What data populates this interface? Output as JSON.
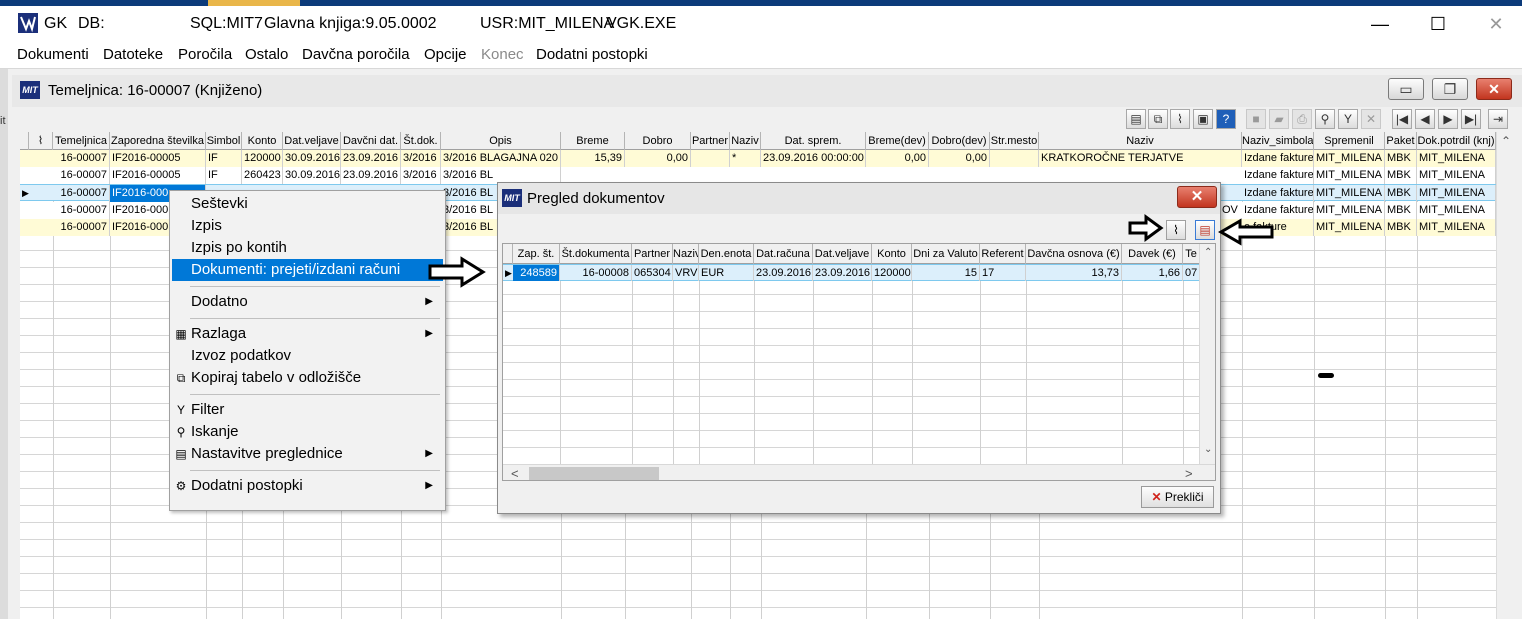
{
  "window": {
    "app_name": "GK",
    "db_label": "DB:",
    "sql": "SQL:MIT7",
    "version": "Glavna knjiga:9.05.0002",
    "user": "USR:MIT_MILENA",
    "exe": "VGK.EXE",
    "minimize_glyph": "—",
    "maximize_glyph": "☐",
    "close_glyph": "✕"
  },
  "menubar": {
    "items": [
      "Dokumenti",
      "Datoteke",
      "Poročila",
      "Ostalo",
      "Davčna poročila",
      "Opcije",
      "Konec",
      "Dodatni postopki"
    ]
  },
  "left_edge_label": "it",
  "child_window": {
    "logo": "MIT",
    "title": "Temeljnica: 16-00007  (Knjiženo)",
    "min_glyph": "▭",
    "restore_glyph": "❐",
    "close_glyph": "✕"
  },
  "toolbar_icons": [
    "document-icon",
    "copy-icon",
    "paperclip-icon",
    "monitor-icon",
    "help-icon",
    "square-icon",
    "folder-icon",
    "print-icon",
    "search-icon",
    "filter-icon",
    "cancel-icon",
    "first-icon",
    "prev-icon",
    "next-icon",
    "last-icon",
    "exit-icon"
  ],
  "toolbar_glyphs": [
    "▤",
    "⧉",
    "⌇",
    "▣",
    "?",
    "■",
    "▰",
    "⎙",
    "⚲",
    "Y",
    "✕",
    "|◀",
    "◀",
    "▶",
    "▶|",
    "⇥"
  ],
  "grid": {
    "attach_glyph": "⌇",
    "columns": [
      "Temeljnica",
      "Zaporedna številka",
      "Simbol",
      "Konto",
      "Dat.veljave",
      "Davčni dat.",
      "Št.dok.",
      "Opis",
      "Breme",
      "Dobro",
      "Partner",
      "Naziv",
      "Dat. sprem.",
      "Breme(dev)",
      "Dobro(dev)",
      "Str.mesto",
      "Naziv",
      "Naziv_simbola",
      "Spremenil",
      "Paket",
      "Dok.potrdil (knj)"
    ],
    "rows": [
      [
        "16-00007",
        "IF2016-00005",
        "IF",
        "120000",
        "30.09.2016",
        "23.09.2016",
        "3/2016",
        "3/2016 BLAGAJNA 020",
        "15,39",
        "0,00",
        "",
        "*",
        "23.09.2016 00:00:00",
        "0,00",
        "0,00",
        "",
        "KRATKOROČNE TERJATVE",
        "Izdane fakture",
        "MIT_MILENA",
        "MBK",
        "MIT_MILENA"
      ],
      [
        "16-00007",
        "IF2016-00005",
        "IF",
        "260423",
        "30.09.2016",
        "23.09.2016",
        "3/2016",
        "3/2016 BL",
        "",
        "",
        "",
        "",
        "",
        "",
        "",
        "",
        "",
        "Izdane fakture",
        "MIT_MILENA",
        "MBK",
        "MIT_MILENA"
      ],
      [
        "16-00007",
        "IF2016-000",
        "",
        "",
        "",
        "",
        "",
        "3/2016 BL",
        "",
        "",
        "",
        "",
        "",
        "",
        "",
        "",
        "",
        "Izdane fakture",
        "MIT_MILENA",
        "MBK",
        "MIT_MILENA"
      ],
      [
        "16-00007",
        "IF2016-000",
        "",
        "",
        "",
        "",
        "",
        "3/2016 BL",
        "",
        "",
        "",
        "",
        "",
        "",
        "",
        "",
        "OV",
        "Izdane fakture",
        "MIT_MILENA",
        "MBK",
        "MIT_MILENA"
      ],
      [
        "16-00007",
        "IF2016-000",
        "",
        "",
        "",
        "",
        "",
        "3/2016 BL",
        "",
        "",
        "",
        "",
        "",
        "",
        "",
        "",
        "",
        "e fakture",
        "MIT_MILENA",
        "MBK",
        "MIT_MILENA"
      ]
    ],
    "row_marker": "▶",
    "scroll_up": "⌃"
  },
  "context_menu": {
    "items": [
      "Seštevki",
      "Izpis",
      "Izpis po kontih",
      "Dokumenti: prejeti/izdani računi",
      "Dodatno",
      "Razlaga",
      "Izvoz podatkov",
      "Kopiraj tabelo v odložišče",
      "Filter",
      "Iskanje",
      "Nastavitve preglednice",
      "Dodatni postopki"
    ],
    "submenu_glyph": "▶"
  },
  "dialog": {
    "logo": "MIT",
    "title": "Pregled dokumentov",
    "close_glyph": "✕",
    "attach_glyph": "⌇",
    "doc_glyph": "▤",
    "columns": [
      "Zap. št.",
      "Št.dokumenta",
      "Partner",
      "Naziv",
      "Den.enota",
      "Dat.računa",
      "Dat.veljave",
      "Konto",
      "Dni za Valuto",
      "Referent",
      "Davčna osnova (€)",
      "Davek (€)",
      "Te"
    ],
    "row": [
      "248589",
      "16-00008",
      "065304",
      "VRV",
      "EUR",
      "23.09.2016",
      "23.09.2016",
      "120000",
      "15",
      "17",
      "13,73",
      "1,66",
      "07"
    ],
    "row_marker": "▶",
    "scroll_up": "⌃",
    "scroll_down": "⌄",
    "scroll_left": "<",
    "scroll_right": ">",
    "cancel_x": "✕",
    "cancel_label": "Prekliči"
  }
}
